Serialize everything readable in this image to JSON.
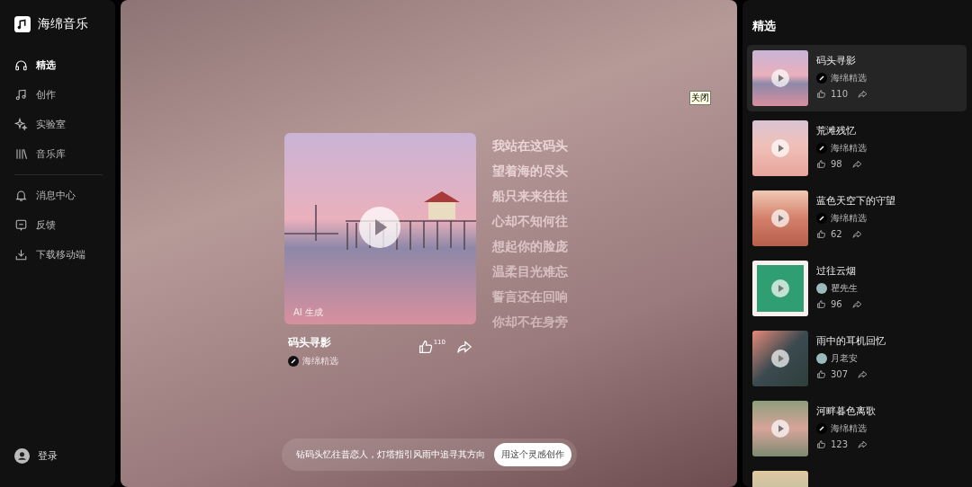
{
  "brand": {
    "name": "海绵音乐"
  },
  "nav": [
    {
      "label": "精选",
      "selected": true
    },
    {
      "label": "创作",
      "selected": false
    },
    {
      "label": "实验室",
      "selected": false
    },
    {
      "label": "音乐库",
      "selected": false
    }
  ],
  "nav_secondary": [
    {
      "label": "消息中心"
    },
    {
      "label": "反馈"
    },
    {
      "label": "下载移动端"
    }
  ],
  "login": {
    "label": "登录"
  },
  "player": {
    "badge": "AI 生成",
    "title": "码头寻影",
    "author": "海绵精选",
    "likes": "110",
    "lyrics": [
      "我站在这码头",
      "望着海的尽头",
      "船只来来往往",
      "心却不知何往",
      "想起你的脸庞",
      "温柔目光难忘",
      "誓言还在回响",
      "你却不在身旁"
    ],
    "prompt": "钻码头忆往昔恋人，灯塔指引风雨中追寻其方向",
    "prompt_button": "用这个灵感创作"
  },
  "tooltip": "关闭",
  "featured": {
    "title": "精选",
    "items": [
      {
        "title": "码头寻影",
        "author": "海绵精选",
        "kind": "official",
        "likes": "110",
        "selected": true
      },
      {
        "title": "荒滩残忆",
        "author": "海绵精选",
        "kind": "official",
        "likes": "98",
        "selected": false
      },
      {
        "title": "蓝色天空下的守望",
        "author": "海绵精选",
        "kind": "official",
        "likes": "62",
        "selected": false
      },
      {
        "title": "过往云烟",
        "author": "瞿先生",
        "kind": "user",
        "likes": "96",
        "selected": false
      },
      {
        "title": "雨中的耳机回忆",
        "author": "月老安",
        "kind": "user",
        "likes": "307",
        "selected": false
      },
      {
        "title": "河畔暮色离歌",
        "author": "海绵精选",
        "kind": "official",
        "likes": "123",
        "selected": false
      }
    ]
  }
}
